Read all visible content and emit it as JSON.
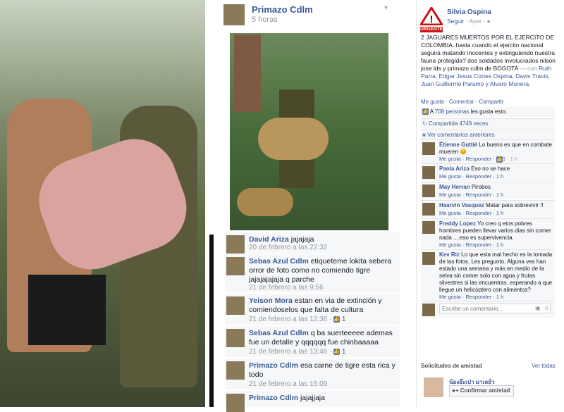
{
  "left_post": {
    "author": "Primazo Cdlm",
    "time": "5 horas"
  },
  "comments_panel": {
    "items": [
      {
        "name": "David Ariza",
        "text": "jajajaja",
        "time": "20 de febrero a las 22:32",
        "likes": ""
      },
      {
        "name": "Sebas Azul Cdlm",
        "text": "etiqueteme lokita sebera orror de foto como no comiendo tigre jajajajajaja q parche",
        "time": "21 de febrero a las 9:56",
        "likes": ""
      },
      {
        "name": "Yeison Mora",
        "text": "estan en via de extinción y comiendoselos que falta de cultura",
        "time": "21 de febrero a las 12:36 · ",
        "likes": "1"
      },
      {
        "name": "Sebas Azul Cdlm",
        "text": "q ba suerteeeee ademas fue un detalle y qqqqqq fue chinbaaaaa",
        "time": "21 de febrero a las 13:46 · ",
        "likes": "1"
      },
      {
        "name": "Primazo Cdlm",
        "text": "esa carne de tigre esta rica y todo",
        "time": "21 de febrero a las 15:09",
        "likes": ""
      },
      {
        "name": "Primazo Cdlm",
        "text": "jajajjaja",
        "time": "",
        "likes": ""
      }
    ]
  },
  "right_post": {
    "badge": "URGENTE",
    "author": "Silvia Ospina",
    "follow": "Seguir",
    "time": " · Ayer · ",
    "body": "2 JAGUARES MUERTOS POR EL EJERCITO DE COLOMBIA. hasta cuando el ejercito nacional seguirá matando inocentes y extinguiendo nuestra fauna protegida? dos soldados involucrados nilson jose lds y primazo cdlm de BOGOTA",
    "with_prefix": " — con ",
    "tagged": "Ruth Parra, Edgar Jesus Cortes Ospina, Davis Travis, Juan Guillermo Paramo y Alvaro Munera.",
    "actions": [
      "Me gusta",
      "Comentar",
      "Compartir"
    ],
    "likes_prefix": "A ",
    "likes_count": "708 personas",
    "likes_suffix": " les gusta esto.",
    "shares": "Compartida 4749 veces",
    "prev_comments": "Ver comentarios anteriores",
    "comments": [
      {
        "name": "Étienne Guttié",
        "text": "Lo bueno es que en combate mueren 😊",
        "meta": "Me gusta · Responder · ",
        "likes": "1",
        "time": " · 1 h"
      },
      {
        "name": "Paola Ariza",
        "text": "Eso no se hace",
        "meta": "Me gusta · Responder · 1 h",
        "likes": "",
        "time": ""
      },
      {
        "name": "May Herran",
        "text": "Pirobos",
        "meta": "Me gusta · Responder · 1 h",
        "likes": "",
        "time": ""
      },
      {
        "name": "Haarvin Vasquez",
        "text": "Matar para sobrevivir !!",
        "meta": "Me gusta · Responder · 1 h",
        "likes": "",
        "time": ""
      },
      {
        "name": "Freddy Lopez",
        "text": "Yo creo q etos pobres hombres pueden llevar varios dias sin comer nada ....eso es supervivencia.",
        "meta": "Me gusta · Responder · 1 h",
        "likes": "",
        "time": ""
      },
      {
        "name": "Kev Riz",
        "text": "Lo que esta mal hecho es la tomada de las fotos. Les pregunto. Alguna ves han estado una semana y más en medio de la selva sin comer solo con agua y frutas silvestres si las encuentras, esperando a que llegue un helicóptero con alimentos?",
        "meta": "Me gusta · Responder · 1 h",
        "likes": "",
        "time": ""
      }
    ],
    "comment_placeholder": "Escribe un comentario..."
  },
  "friend_requests": {
    "title": "Solicitudes de amistad",
    "see_all": "Ver todas",
    "name": "น้องอ๊ะเป่า มาเลย์ว",
    "confirm": "Confirmar amistad"
  },
  "colors": {
    "fb_blue": "#3b5998",
    "link": "#3b5998",
    "urgent": "#cc1111"
  }
}
